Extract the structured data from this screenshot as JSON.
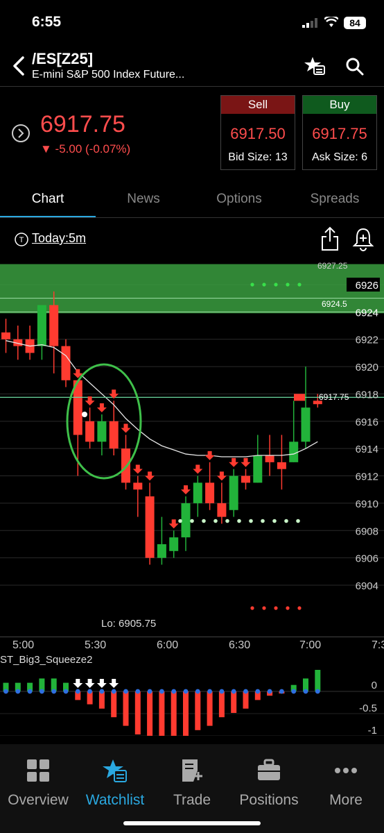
{
  "status": {
    "time": "6:55",
    "battery": "84"
  },
  "header": {
    "symbol": "/ES[Z25]",
    "name": "E-mini S&P 500 Index Future..."
  },
  "quote": {
    "last": "6917.75",
    "change": "▼ -5.00 (-0.07%)",
    "sell": {
      "label": "Sell",
      "price": "6917.50",
      "size": "Bid Size: 13"
    },
    "buy": {
      "label": "Buy",
      "price": "6917.75",
      "size": "Ask Size: 6"
    }
  },
  "tabs": [
    "Chart",
    "News",
    "Options",
    "Spreads"
  ],
  "chart": {
    "timeframe": "Today:5m",
    "price_labels": [
      "6926",
      "6924",
      "6922",
      "6920",
      "6918",
      "6916",
      "6914",
      "6912",
      "6910",
      "6908",
      "6906",
      "6904"
    ],
    "top_marker": "6927.25",
    "zone_marker": "6924.5",
    "last_marker": "6917.75",
    "low_label": "Lo: 6905.75",
    "time_labels": [
      "5:00",
      "5:30",
      "6:00",
      "6:30",
      "7:00",
      "7:3"
    ],
    "indicator_name": "ST_Big3_Squeeze2",
    "indicator_labels": [
      "0",
      "-0.5",
      "-1"
    ]
  },
  "chart_data": {
    "type": "candlestick",
    "ylim": [
      6903,
      6928
    ],
    "candles": [
      {
        "o": 6922.5,
        "h": 6923.5,
        "l": 6921.0,
        "c": 6922.0
      },
      {
        "o": 6922.0,
        "h": 6923.0,
        "l": 6920.5,
        "c": 6921.5
      },
      {
        "o": 6922.0,
        "h": 6923.0,
        "l": 6920.5,
        "c": 6921.0
      },
      {
        "o": 6921.5,
        "h": 6924.5,
        "l": 6920.5,
        "c": 6924.5
      },
      {
        "o": 6924.5,
        "h": 6925.5,
        "l": 6919.5,
        "c": 6921.5
      },
      {
        "o": 6921.5,
        "h": 6922.0,
        "l": 6918.5,
        "c": 6919.0
      },
      {
        "o": 6919.0,
        "h": 6919.0,
        "l": 6912.0,
        "c": 6915.0
      },
      {
        "o": 6916.0,
        "h": 6917.0,
        "l": 6914.0,
        "c": 6914.5
      },
      {
        "o": 6914.5,
        "h": 6916.5,
        "l": 6913.5,
        "c": 6916.0
      },
      {
        "o": 6916.0,
        "h": 6917.5,
        "l": 6913.5,
        "c": 6914.0
      },
      {
        "o": 6914.0,
        "h": 6915.0,
        "l": 6911.0,
        "c": 6911.5
      },
      {
        "o": 6911.5,
        "h": 6912.0,
        "l": 6909.0,
        "c": 6911.0
      },
      {
        "o": 6910.5,
        "h": 6911.5,
        "l": 6905.5,
        "c": 6906.0
      },
      {
        "o": 6906.0,
        "h": 6909.0,
        "l": 6905.5,
        "c": 6907.0
      },
      {
        "o": 6906.5,
        "h": 6908.0,
        "l": 6906.0,
        "c": 6907.5
      },
      {
        "o": 6907.5,
        "h": 6910.5,
        "l": 6906.5,
        "c": 6910.0
      },
      {
        "o": 6910.0,
        "h": 6912.0,
        "l": 6909.0,
        "c": 6911.5
      },
      {
        "o": 6911.5,
        "h": 6913.0,
        "l": 6909.5,
        "c": 6910.0
      },
      {
        "o": 6910.0,
        "h": 6911.5,
        "l": 6908.5,
        "c": 6909.0
      },
      {
        "o": 6909.5,
        "h": 6912.5,
        "l": 6909.0,
        "c": 6912.0
      },
      {
        "o": 6912.0,
        "h": 6912.5,
        "l": 6911.0,
        "c": 6911.5
      },
      {
        "o": 6911.5,
        "h": 6915.0,
        "l": 6911.5,
        "c": 6913.5
      },
      {
        "o": 6913.5,
        "h": 6915.0,
        "l": 6912.0,
        "c": 6913.0
      },
      {
        "o": 6913.0,
        "h": 6915.0,
        "l": 6911.0,
        "c": 6912.5
      },
      {
        "o": 6913.0,
        "h": 6917.5,
        "l": 6913.0,
        "c": 6914.5
      },
      {
        "o": 6914.5,
        "h": 6920.0,
        "l": 6914.0,
        "c": 6917.0
      },
      {
        "o": 6917.5,
        "h": 6918.0,
        "l": 6917.0,
        "c": 6917.25
      }
    ],
    "sma": [
      6921.9,
      6921.7,
      6921.5,
      6921.6,
      6921.4,
      6920.8,
      6919.6,
      6918.8,
      6918.0,
      6917.2,
      6916.2,
      6915.4,
      6914.7,
      6914.2,
      6913.9,
      6913.6,
      6913.5,
      6913.5,
      6913.4,
      6913.4,
      6913.4,
      6913.5,
      6913.5,
      6913.5,
      6913.6,
      6914.0,
      6914.5
    ],
    "histogram": [
      0.2,
      0.2,
      0.2,
      0.3,
      0.3,
      0.2,
      -0.2,
      -0.3,
      -0.4,
      -0.6,
      -0.8,
      -1.0,
      -1.1,
      -1.2,
      -1.2,
      -1.1,
      -0.9,
      -0.8,
      -0.6,
      -0.5,
      -0.4,
      -0.2,
      -0.1,
      -0.05,
      0.15,
      0.3,
      0.5
    ],
    "hist_ylim": [
      -1.3,
      0.6
    ],
    "sell_arrows": [
      6,
      7,
      8,
      9,
      10,
      11,
      12,
      14,
      15,
      16,
      17,
      18,
      19,
      20
    ],
    "squeeze_marks": [
      6,
      7,
      8,
      9
    ]
  },
  "bottom_nav": [
    {
      "label": "Overview",
      "icon": "overview-grid-icon"
    },
    {
      "label": "Watchlist",
      "icon": "watchlist-star-icon"
    },
    {
      "label": "Trade",
      "icon": "trade-ticket-icon"
    },
    {
      "label": "Positions",
      "icon": "briefcase-icon"
    },
    {
      "label": "More",
      "icon": "more-dots-icon"
    }
  ],
  "colors": {
    "up": "#22b33a",
    "down": "#ff3b30",
    "accent": "#2aa8e0",
    "zone": "#3a9d3f"
  }
}
